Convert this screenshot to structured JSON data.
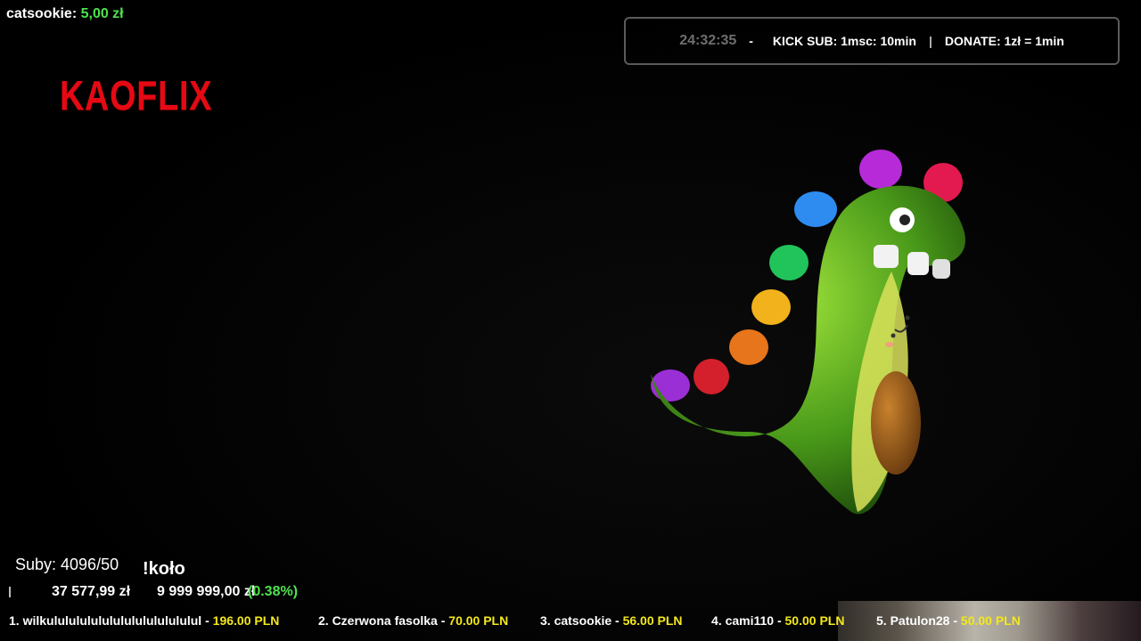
{
  "alert": {
    "user": "catsookie:",
    "amount": "5,00 zł"
  },
  "logo": {
    "text": "KAOFLIX"
  },
  "info_bar": {
    "timer": "24:32:35",
    "dash": "-",
    "kick_sub": "KICK SUB: 1msc: 10min",
    "separator": "|",
    "donate": "DONATE: 1zł = 1min"
  },
  "stats": {
    "subs": "Suby: 4096/50",
    "command": "!koło",
    "raised": "37 577,99 zł",
    "target": "9 999 999,00 zł",
    "percent": "(0.38%)"
  },
  "top_donors": [
    {
      "name": "1. wilkulululululululululululululul - ",
      "amount": "196.00 PLN"
    },
    {
      "name": "2. Czerwona fasolka - ",
      "amount": "70.00 PLN"
    },
    {
      "name": "3. catsookie - ",
      "amount": "56.00 PLN"
    },
    {
      "name": "4. cami110 - ",
      "amount": "50.00 PLN"
    },
    {
      "name": "5. Patulon28 - ",
      "amount": "50.00 PLN"
    }
  ],
  "colors": {
    "brand_red": "#e50914",
    "green": "#4ee24e",
    "yellow": "#f3e81c"
  }
}
